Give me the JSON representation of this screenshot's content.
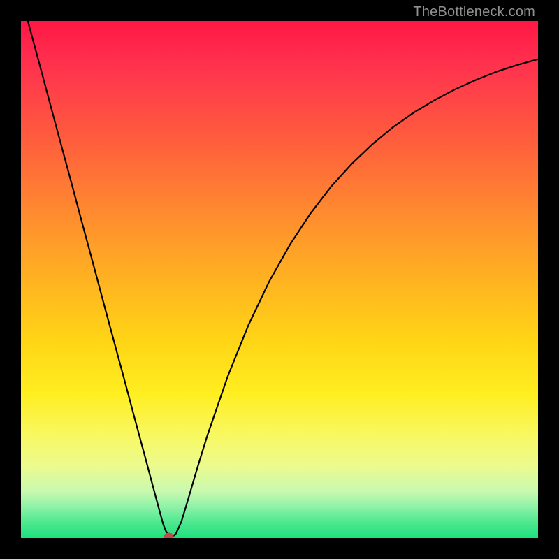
{
  "watermark": {
    "text": "TheBottleneck.com"
  },
  "chart_data": {
    "type": "line",
    "title": "",
    "xlabel": "",
    "ylabel": "",
    "xlim": [
      0,
      100
    ],
    "ylim": [
      0,
      100
    ],
    "grid": false,
    "legend": null,
    "series": [
      {
        "name": "bottleneck-curve",
        "x": [
          0,
          2,
          4,
          6,
          8,
          10,
          12,
          14,
          16,
          18,
          20,
          22,
          24,
          26,
          27,
          27.5,
          28,
          28.5,
          29,
          29.5,
          30,
          31,
          32,
          34,
          36,
          40,
          44,
          48,
          52,
          56,
          60,
          64,
          68,
          72,
          76,
          80,
          84,
          88,
          92,
          96,
          100
        ],
        "y": [
          105,
          97.5,
          90.1,
          82.6,
          75.2,
          67.8,
          60.3,
          52.9,
          45.4,
          38.0,
          30.6,
          23.1,
          15.7,
          8.2,
          4.5,
          2.7,
          1.4,
          0.6,
          0.3,
          0.4,
          0.9,
          3.1,
          6.4,
          13.2,
          19.7,
          31.3,
          41.2,
          49.6,
          56.7,
          62.8,
          68.0,
          72.4,
          76.2,
          79.5,
          82.3,
          84.7,
          86.8,
          88.6,
          90.2,
          91.5,
          92.6
        ]
      }
    ],
    "marker": {
      "x_percent": 28.6,
      "y_percent": 0.0,
      "color": "#c24a4a"
    },
    "background_gradient": {
      "type": "vertical",
      "stops": [
        {
          "pos": 0.0,
          "color": "#ff1744"
        },
        {
          "pos": 0.22,
          "color": "#ff5a3e"
        },
        {
          "pos": 0.42,
          "color": "#ff9a2a"
        },
        {
          "pos": 0.62,
          "color": "#ffd516"
        },
        {
          "pos": 0.8,
          "color": "#f8f860"
        },
        {
          "pos": 0.94,
          "color": "#8df2a8"
        },
        {
          "pos": 1.0,
          "color": "#1fe07e"
        }
      ]
    }
  }
}
